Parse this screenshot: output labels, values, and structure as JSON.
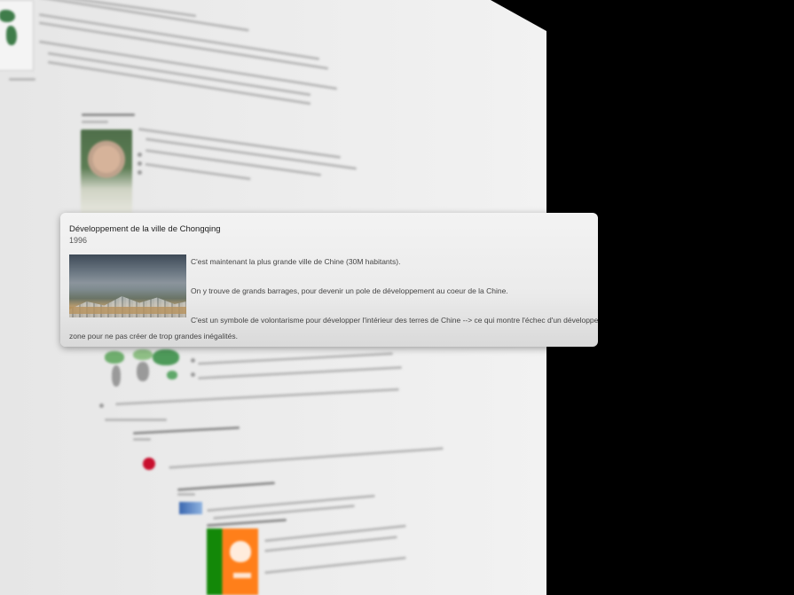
{
  "card": {
    "title": "Développement de la ville de Chongqing",
    "year": "1996",
    "image_alt": "Vue aérienne de Chongqing",
    "paragraphs": [
      "C'est maintenant la plus grande ville de Chine (30M habitants).",
      "On y trouve de grands barrages, pour devenir un pole de développement au coeur de la Chine.",
      "C'est un symbole de volontarisme pour développer l'intérieur des terres de Chine --> ce qui montre l'échec d'un développement uniforme",
      "zone pour ne pas créer de trop grandes inégalités."
    ]
  },
  "colors": {
    "background": "#000000",
    "page": "#eeeeee",
    "card": "#ececec"
  }
}
